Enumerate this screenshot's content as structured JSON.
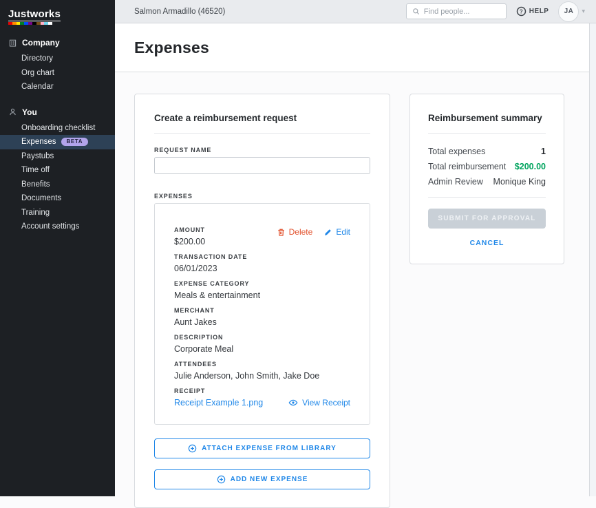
{
  "sidebar": {
    "logo": "Justworks",
    "logo_stripe_colors": [
      "#e40303",
      "#ff8c00",
      "#ffed00",
      "#008026",
      "#004dff",
      "#750787",
      "#000000",
      "#784f17",
      "#ffafc8",
      "#74d7ee",
      "#ffffff"
    ],
    "sections": [
      {
        "label": "Company",
        "icon": "building-icon",
        "items": [
          {
            "label": "Directory"
          },
          {
            "label": "Org chart"
          },
          {
            "label": "Calendar"
          }
        ]
      },
      {
        "label": "You",
        "icon": "person-icon",
        "items": [
          {
            "label": "Onboarding checklist"
          },
          {
            "label": "Expenses",
            "badge": "BETA",
            "active": true
          },
          {
            "label": "Paystubs"
          },
          {
            "label": "Time off"
          },
          {
            "label": "Benefits"
          },
          {
            "label": "Documents"
          },
          {
            "label": "Training"
          },
          {
            "label": "Account settings"
          }
        ]
      }
    ]
  },
  "topbar": {
    "company": "Salmon Armadillo (46520)",
    "search_placeholder": "Find people...",
    "help_label": "HELP",
    "avatar_initials": "JA"
  },
  "page": {
    "title": "Expenses"
  },
  "form": {
    "title": "Create a reimbursement request",
    "request_name_label": "REQUEST NAME",
    "request_name_value": "",
    "expenses_label": "EXPENSES",
    "expense": {
      "delete_label": "Delete",
      "edit_label": "Edit",
      "fields": [
        {
          "label": "AMOUNT",
          "value": "$200.00"
        },
        {
          "label": "TRANSACTION DATE",
          "value": "06/01/2023"
        },
        {
          "label": "EXPENSE CATEGORY",
          "value": "Meals & entertainment"
        },
        {
          "label": "MERCHANT",
          "value": "Aunt Jakes"
        },
        {
          "label": "DESCRIPTION",
          "value": "Corporate Meal"
        },
        {
          "label": "ATTENDEES",
          "value": "Julie Anderson, John Smith, Jake Doe"
        }
      ],
      "receipt_label": "RECEIPT",
      "receipt_file": "Receipt Example 1.png",
      "view_receipt_label": "View Receipt"
    },
    "attach_button": "ATTACH EXPENSE FROM LIBRARY",
    "add_button": "ADD NEW EXPENSE"
  },
  "summary": {
    "title": "Reimbursement summary",
    "rows": [
      {
        "label": "Total expenses",
        "value": "1"
      },
      {
        "label": "Total reimbursement",
        "value": "$200.00"
      },
      {
        "label": "Admin Review",
        "value": "Monique King"
      }
    ],
    "submit_button": "SUBMIT FOR APPROVAL",
    "cancel_button": "CANCEL"
  },
  "colors": {
    "accent_blue": "#1f87e8",
    "danger_orange": "#e2532f",
    "success_green": "#00a45e",
    "beta_badge_bg": "#b2a4eb",
    "sidebar_bg": "#1d2024",
    "sidebar_active_bg": "#2d4156",
    "topbar_bg": "#e9ebee",
    "disabled_button_bg": "#c9d0d7"
  }
}
